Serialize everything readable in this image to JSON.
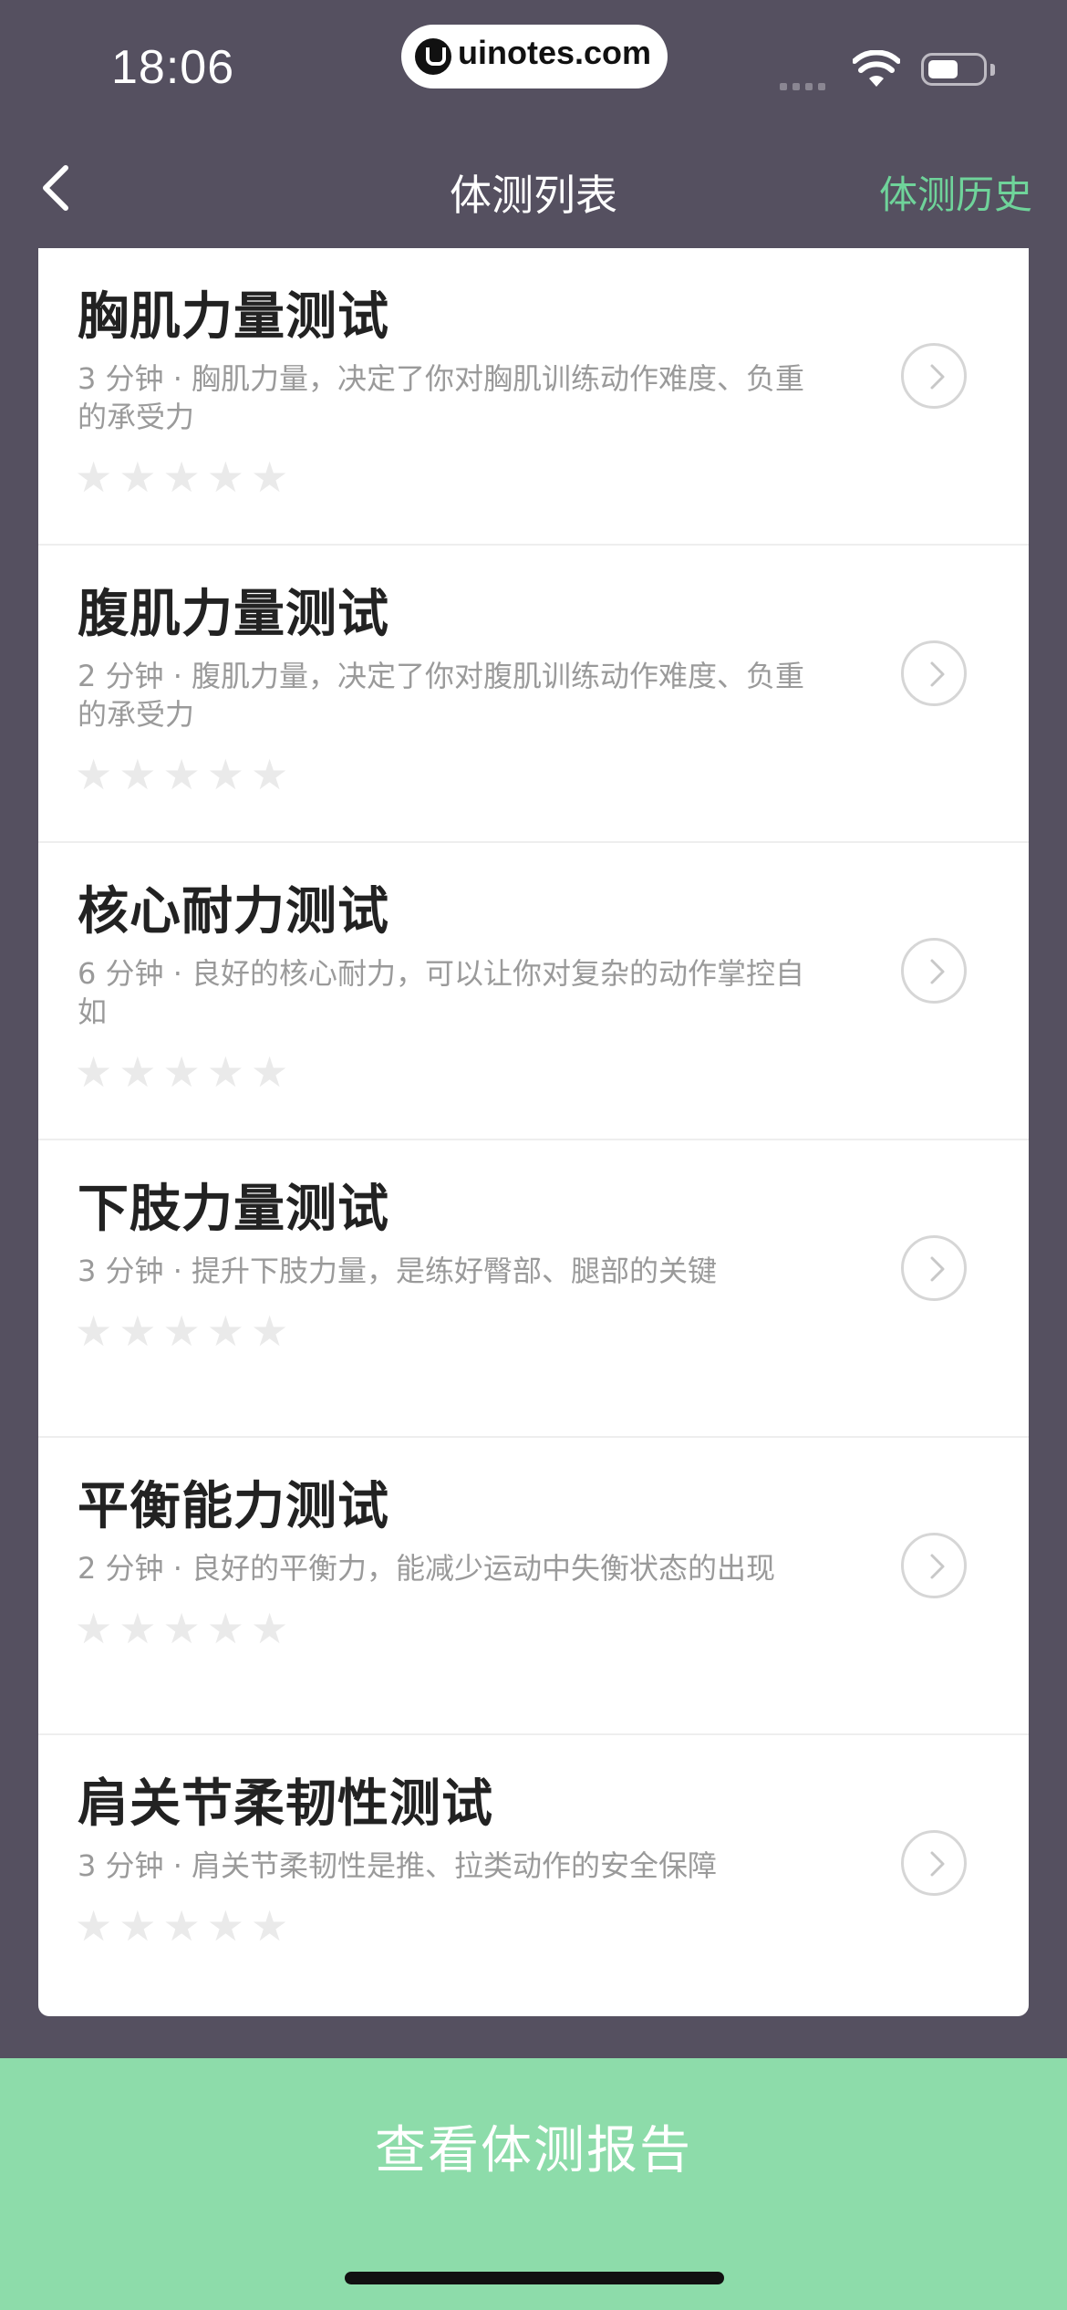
{
  "status_bar": {
    "time": "18:06",
    "site_badge": "uinotes.com"
  },
  "nav": {
    "title": "体测列表",
    "history_label": "体测历史",
    "back_icon": "chevron-left-icon"
  },
  "tests": [
    {
      "title": "胸肌力量测试",
      "desc": "3 分钟 · 胸肌力量，决定了你对胸肌训练动作难度、负重的承受力",
      "rating": 0
    },
    {
      "title": "腹肌力量测试",
      "desc": "2 分钟 · 腹肌力量，决定了你对腹肌训练动作难度、负重的承受力",
      "rating": 0
    },
    {
      "title": "核心耐力测试",
      "desc": "6 分钟 · 良好的核心耐力，可以让你对复杂的动作掌控自如",
      "rating": 0
    },
    {
      "title": "下肢力量测试",
      "desc": "3 分钟 · 提升下肢力量，是练好臀部、腿部的关键",
      "rating": 0
    },
    {
      "title": "平衡能力测试",
      "desc": "2 分钟 · 良好的平衡力，能减少运动中失衡状态的出现",
      "rating": 0
    },
    {
      "title": "肩关节柔韧性测试",
      "desc": "3 分钟 · 肩关节柔韧性是推、拉类动作的安全保障",
      "rating": 0
    }
  ],
  "footer": {
    "report_label": "查看体测报告"
  },
  "colors": {
    "accent": "#6fd39a",
    "background": "#555060",
    "report_bar": "#8ddcaa"
  }
}
